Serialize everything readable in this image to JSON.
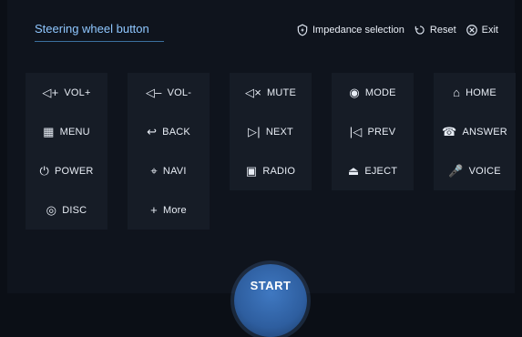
{
  "tabs": {
    "active_label": "Steering wheel button"
  },
  "top_actions": [
    {
      "label": "Impedance selection",
      "icon": "shield-icon"
    },
    {
      "label": "Reset",
      "icon": "reset-icon"
    },
    {
      "label": "Exit",
      "icon": "close-circle-icon"
    }
  ],
  "buttons": [
    {
      "label": "VOL+",
      "icon": "volume-up-icon",
      "glyph": "◁+"
    },
    {
      "label": "VOL-",
      "icon": "volume-down-icon",
      "glyph": "◁–"
    },
    {
      "label": "MUTE",
      "icon": "mute-icon",
      "glyph": "◁×"
    },
    {
      "label": "MODE",
      "icon": "mode-icon",
      "glyph": "◉"
    },
    {
      "label": "HOME",
      "icon": "home-icon",
      "glyph": "⌂"
    },
    {
      "label": "MENU",
      "icon": "menu-grid-icon",
      "glyph": "▦"
    },
    {
      "label": "BACK",
      "icon": "back-arrow-icon",
      "glyph": "↩"
    },
    {
      "label": "NEXT",
      "icon": "next-icon",
      "glyph": "▷|"
    },
    {
      "label": "PREV",
      "icon": "prev-icon",
      "glyph": "|◁"
    },
    {
      "label": "ANSWER",
      "icon": "phone-icon",
      "glyph": "☎"
    },
    {
      "label": "POWER",
      "icon": "power-icon",
      "glyph": "⏻"
    },
    {
      "label": "NAVI",
      "icon": "location-pin-icon",
      "glyph": "⌖"
    },
    {
      "label": "RADIO",
      "icon": "radio-icon",
      "glyph": "▣"
    },
    {
      "label": "EJECT",
      "icon": "eject-icon",
      "glyph": "⏏"
    },
    {
      "label": "VOICE",
      "icon": "microphone-icon",
      "glyph": "🎤"
    },
    {
      "label": "DISC",
      "icon": "disc-icon",
      "glyph": "◎"
    },
    {
      "label": "More",
      "icon": "plus-icon",
      "glyph": "+"
    }
  ],
  "start": {
    "label": "START"
  }
}
